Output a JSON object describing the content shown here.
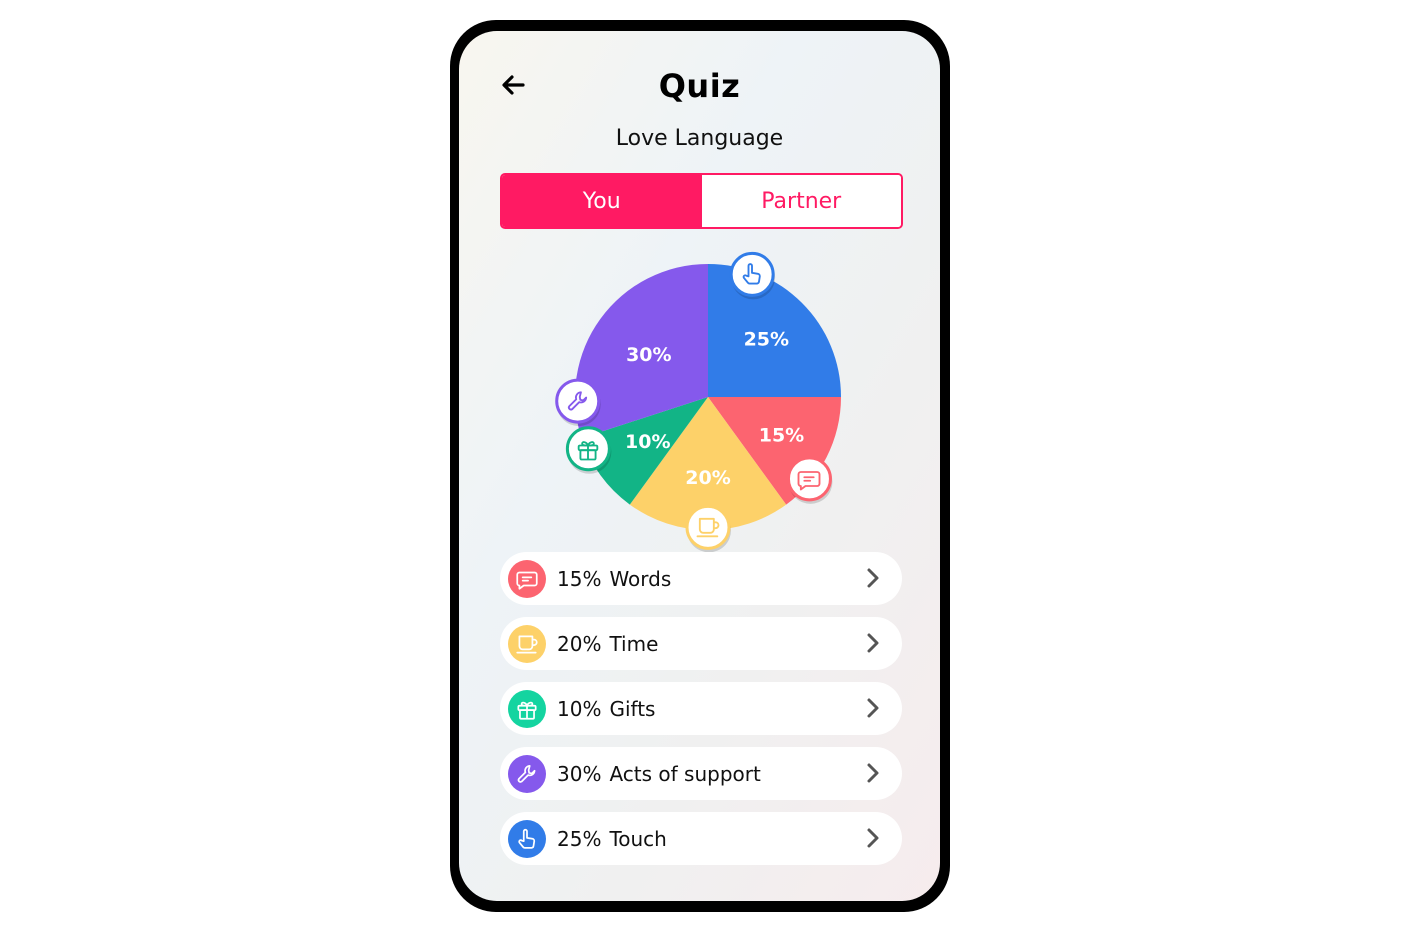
{
  "header": {
    "title": "Quiz",
    "subtitle": "Love Language",
    "back_icon": "arrow-left-icon"
  },
  "tabs": [
    {
      "label": "You",
      "active": true
    },
    {
      "label": "Partner",
      "active": false
    }
  ],
  "colors": {
    "accent": "#ff1a63",
    "words": "#fc6470",
    "time": "#fdd169",
    "gifts": "#12b486",
    "gifts_list": "#14d4a0",
    "support": "#8559ec",
    "touch": "#317ce8"
  },
  "chart_data": {
    "type": "pie",
    "title": "Love Language",
    "start_angle_deg": 0,
    "direction": "clockwise-from-top",
    "slices": [
      {
        "key": "touch",
        "label": "25%",
        "name": "Touch",
        "value": 25,
        "color": "#317ce8",
        "icon": "hand-pointing-icon"
      },
      {
        "key": "words",
        "label": "15%",
        "name": "Words",
        "value": 15,
        "color": "#fc6470",
        "icon": "chat-bubble-icon"
      },
      {
        "key": "time",
        "label": "20%",
        "name": "Time",
        "value": 20,
        "color": "#fdd169",
        "icon": "coffee-cup-icon"
      },
      {
        "key": "gifts",
        "label": "10%",
        "name": "Gifts",
        "value": 10,
        "color": "#12b486",
        "icon": "gift-icon"
      },
      {
        "key": "support",
        "label": "30%",
        "name": "Acts of support",
        "value": 30,
        "color": "#8559ec",
        "icon": "wrench-icon"
      }
    ]
  },
  "list": [
    {
      "key": "words",
      "pct": "15%",
      "name": "Words",
      "icon": "chat-bubble-icon",
      "color": "#fc6470"
    },
    {
      "key": "time",
      "pct": "20%",
      "name": "Time",
      "icon": "coffee-cup-icon",
      "color": "#fdd169"
    },
    {
      "key": "gifts",
      "pct": "10%",
      "name": "Gifts",
      "icon": "gift-icon",
      "color": "#14d4a0"
    },
    {
      "key": "support",
      "pct": "30%",
      "name": "Acts of support",
      "icon": "wrench-icon",
      "color": "#8559ec"
    },
    {
      "key": "touch",
      "pct": "25%",
      "name": "Touch",
      "icon": "hand-pointing-icon",
      "color": "#317ce8"
    }
  ]
}
